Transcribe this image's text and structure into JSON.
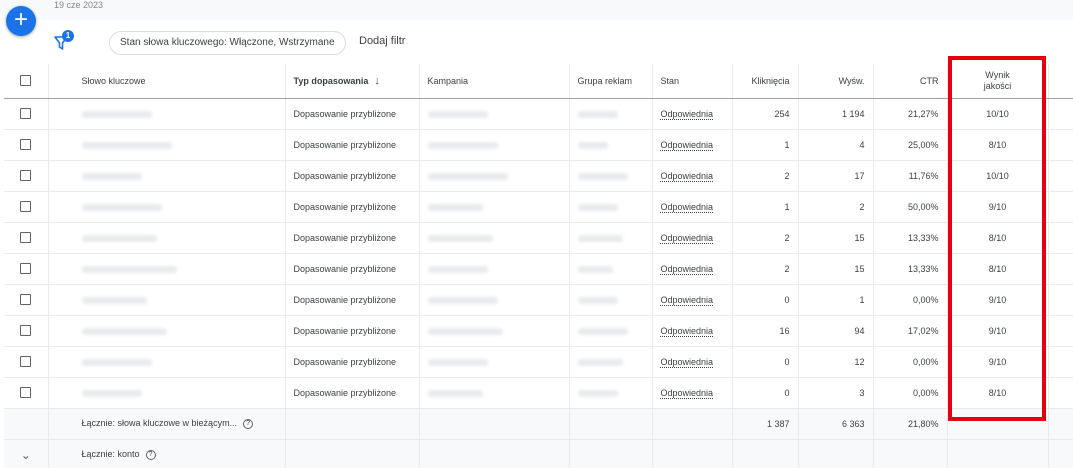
{
  "header": {
    "date": "19 cze 2023",
    "fab_symbol": "+",
    "filter_badge": "1",
    "filter_chip": "Stan słowa kluczowego: Włączone, Wstrzymane",
    "add_filter": "Dodaj filtr"
  },
  "columns": {
    "keyword": "Słowo kluczowe",
    "match_type": "Typ dopasowania",
    "campaign": "Kampania",
    "ad_group": "Grupa reklam",
    "status": "Stan",
    "clicks": "Kliknięcia",
    "impressions": "Wyśw.",
    "ctr": "CTR",
    "quality_line1": "Wynik",
    "quality_line2": "jakości"
  },
  "rows": [
    {
      "match": "Dopasowanie przybliżone",
      "status": "Odpowiednia",
      "clicks": "254",
      "impr": "1 194",
      "ctr": "21,27%",
      "quality": "10/10"
    },
    {
      "match": "Dopasowanie przybliżone",
      "status": "Odpowiednia",
      "clicks": "1",
      "impr": "4",
      "ctr": "25,00%",
      "quality": "8/10"
    },
    {
      "match": "Dopasowanie przybliżone",
      "status": "Odpowiednia",
      "clicks": "2",
      "impr": "17",
      "ctr": "11,76%",
      "quality": "10/10"
    },
    {
      "match": "Dopasowanie przybliżone",
      "status": "Odpowiednia",
      "clicks": "1",
      "impr": "2",
      "ctr": "50,00%",
      "quality": "9/10"
    },
    {
      "match": "Dopasowanie przybliżone",
      "status": "Odpowiednia",
      "clicks": "2",
      "impr": "15",
      "ctr": "13,33%",
      "quality": "8/10"
    },
    {
      "match": "Dopasowanie przybliżone",
      "status": "Odpowiednia",
      "clicks": "2",
      "impr": "15",
      "ctr": "13,33%",
      "quality": "8/10"
    },
    {
      "match": "Dopasowanie przybliżone",
      "status": "Odpowiednia",
      "clicks": "0",
      "impr": "1",
      "ctr": "0,00%",
      "quality": "9/10"
    },
    {
      "match": "Dopasowanie przybliżone",
      "status": "Odpowiednia",
      "clicks": "16",
      "impr": "94",
      "ctr": "17,02%",
      "quality": "9/10"
    },
    {
      "match": "Dopasowanie przybliżone",
      "status": "Odpowiednia",
      "clicks": "0",
      "impr": "12",
      "ctr": "0,00%",
      "quality": "9/10"
    },
    {
      "match": "Dopasowanie przybliżone",
      "status": "Odpowiednia",
      "clicks": "0",
      "impr": "3",
      "ctr": "0,00%",
      "quality": "8/10"
    }
  ],
  "totals": {
    "current_label": "Łącznie: słowa kluczowe w bieżącym...",
    "clicks": "1 387",
    "impr": "6 363",
    "ctr": "21,80%",
    "account_label": "Łącznie: konto"
  },
  "colors": {
    "accent": "#1a73e8",
    "highlight": "#e3000f"
  }
}
